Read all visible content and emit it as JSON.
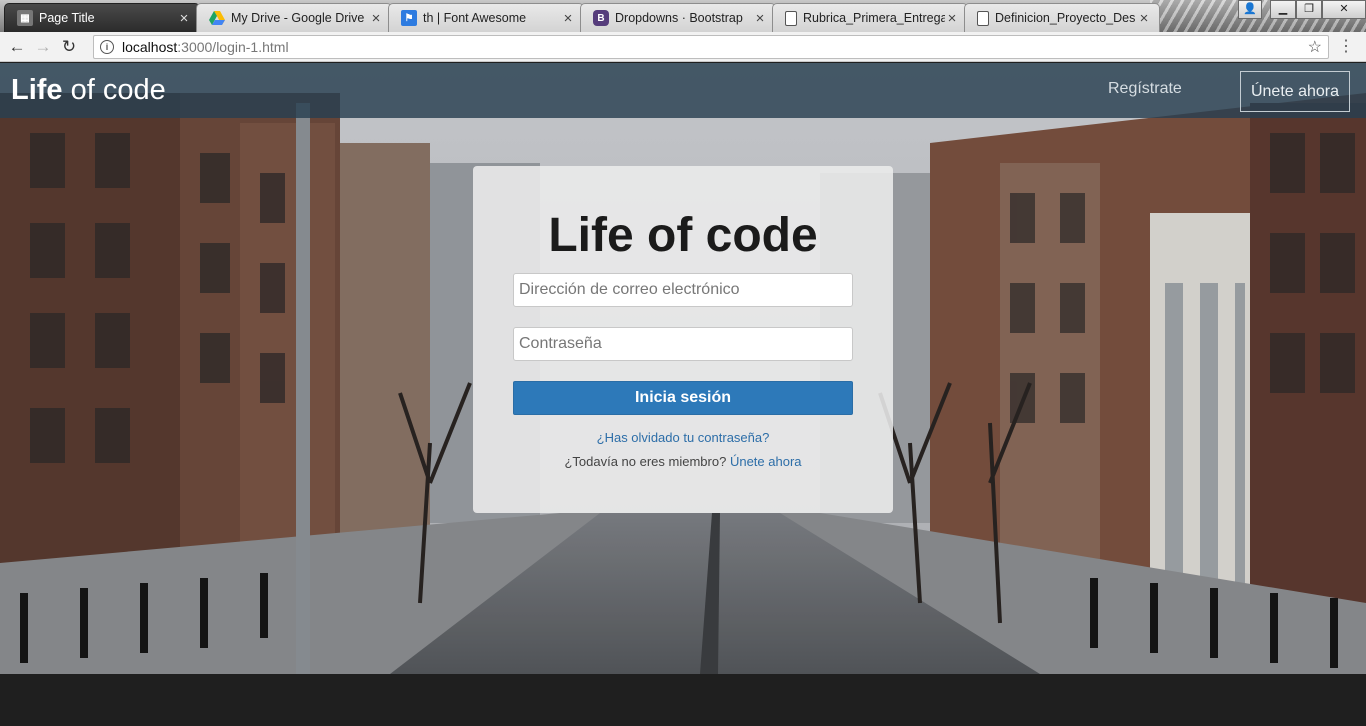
{
  "browser": {
    "tabs": [
      {
        "title": "Page Title",
        "icon": "generic-page-icon",
        "active": true
      },
      {
        "title": "My Drive - Google Drive",
        "icon": "google-drive-icon",
        "active": false
      },
      {
        "title": "th | Font Awesome",
        "icon": "font-awesome-flag-icon",
        "active": false
      },
      {
        "title": "Dropdowns · Bootstrap",
        "icon": "bootstrap-icon",
        "active": false
      },
      {
        "title": "Rubrica_Primera_Entrega",
        "icon": "document-icon",
        "active": false
      },
      {
        "title": "Definicion_Proyecto_Des",
        "icon": "document-icon",
        "active": false
      }
    ],
    "close_glyph": "×",
    "url_host": "localhost",
    "url_path": ":3000/login-1.html"
  },
  "site": {
    "brand_bold": "Life",
    "brand_rest": " of code",
    "nav_register": "Regístrate",
    "nav_join": "Únete ahora"
  },
  "login": {
    "title": "Life of code",
    "email_placeholder": "Dirección de correo electrónico",
    "password_placeholder": "Contraseña",
    "submit_label": "Inicia sesión",
    "forgot_label": "¿Has olvidado tu contraseña?",
    "member_prompt": "¿Todavía no eres miembro?",
    "join_link": "Únete ahora"
  },
  "colors": {
    "navbar": "#284050",
    "primary_button": "#2d79b9",
    "link": "#2d6ea8",
    "footer": "#1f1f1f"
  }
}
